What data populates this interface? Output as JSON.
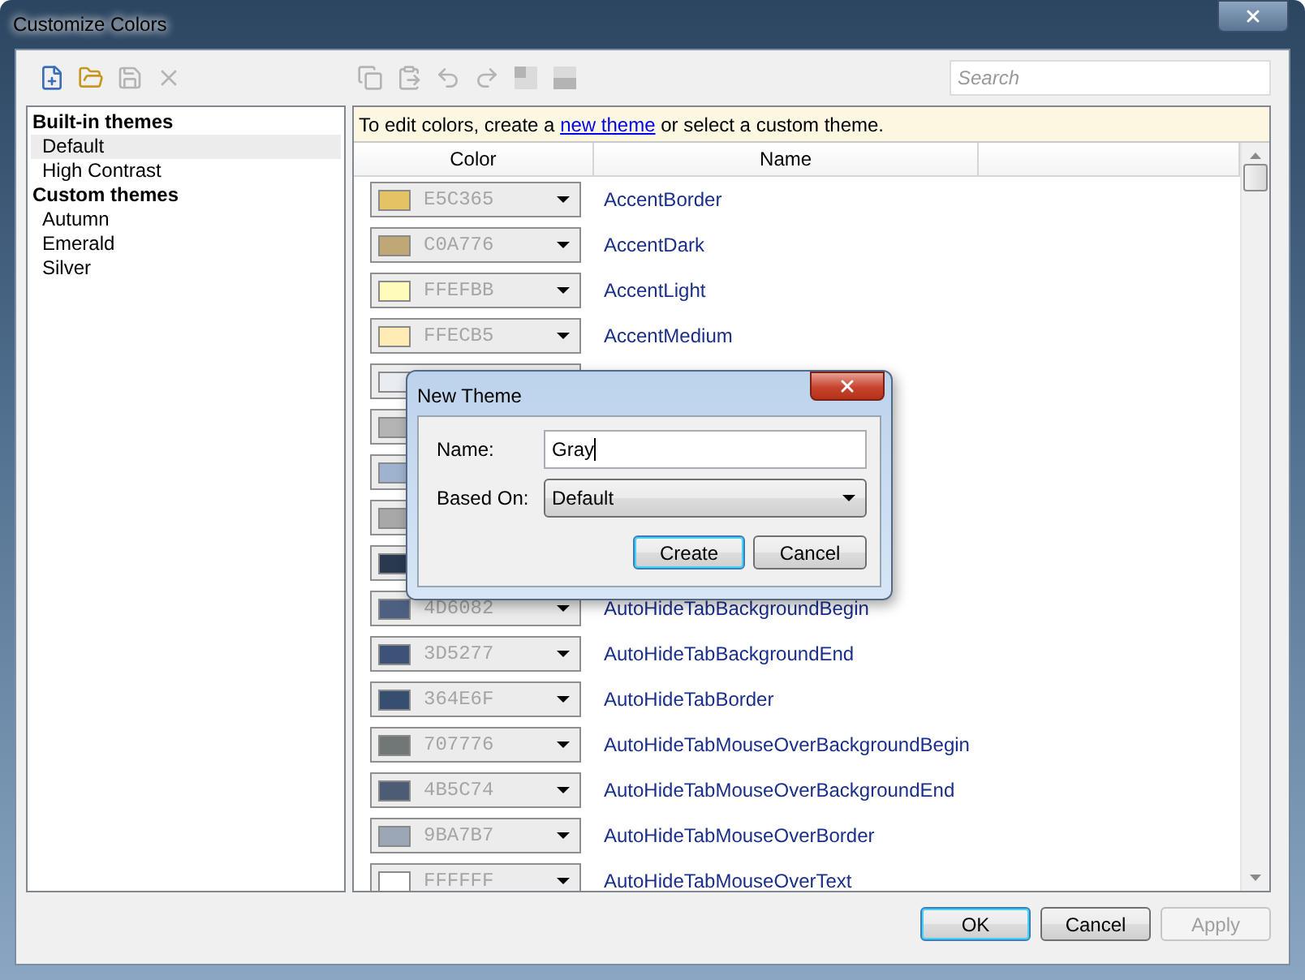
{
  "window": {
    "title": "Customize Colors"
  },
  "toolbar": [
    {
      "kind": "new",
      "disabled": false
    },
    {
      "kind": "open",
      "disabled": false
    },
    {
      "kind": "save",
      "disabled": true
    },
    {
      "kind": "delete",
      "disabled": true
    }
  ],
  "edit_toolbar": [
    {
      "kind": "copy",
      "disabled": true
    },
    {
      "kind": "paste",
      "disabled": true
    },
    {
      "kind": "undo",
      "disabled": true
    },
    {
      "kind": "redo",
      "disabled": true
    },
    {
      "kind": "grid-a",
      "disabled": true
    },
    {
      "kind": "grid-b",
      "disabled": true
    }
  ],
  "search": {
    "placeholder": "Search"
  },
  "themes": [
    {
      "heading": "Built-in themes",
      "items": [
        {
          "label": "Default",
          "selected": true
        },
        {
          "label": "High Contrast",
          "selected": false
        }
      ]
    },
    {
      "heading": "Custom themes",
      "items": [
        {
          "label": "Autumn",
          "selected": false
        },
        {
          "label": "Emerald",
          "selected": false
        },
        {
          "label": "Silver",
          "selected": false
        }
      ]
    }
  ],
  "info": {
    "before": "To edit colors, create a",
    "link": "new theme",
    "after": "or select a custom theme."
  },
  "table": {
    "columns": [
      "Color",
      "Name"
    ],
    "rows": [
      {
        "color": "#e5c365",
        "hex": "E5C365",
        "name": "AccentBorder"
      },
      {
        "color": "#c0a776",
        "hex": "C0A776",
        "name": "AccentDark"
      },
      {
        "color": "#fffbbb",
        "hex": "FFEFBB",
        "name": "AccentLight"
      },
      {
        "color": "#ffecb5",
        "hex": "FFECB5",
        "name": "AccentMedium"
      },
      {
        "color": "#e9ecf1"
      },
      {
        "color": "#b4b4b4"
      },
      {
        "color": "#9fb3cf"
      },
      {
        "color": "#a8a8a8"
      },
      {
        "color": "#293950"
      },
      {
        "color": "#4d6082",
        "hex": "4D6082",
        "name": "AutoHideTabBackgroundBegin"
      },
      {
        "color": "#3d5277",
        "hex": "3D5277",
        "name": "AutoHideTabBackgroundEnd"
      },
      {
        "color": "#364e6f",
        "hex": "364E6F",
        "name": "AutoHideTabBorder"
      },
      {
        "color": "#707776",
        "hex": "707776",
        "name": "AutoHideTabMouseOverBackgroundBegin"
      },
      {
        "color": "#4b5c74",
        "hex": "4B5C74",
        "name": "AutoHideTabMouseOverBackgroundEnd"
      },
      {
        "color": "#9ba7b7",
        "hex": "9BA7B7",
        "name": "AutoHideTabMouseOverBorder"
      },
      {
        "color": "#ffffff",
        "hex": "FFFFFF",
        "name": "AutoHideTabMouseOverText"
      }
    ]
  },
  "buttons": [
    {
      "label": "OK",
      "focused": true,
      "disabled": false
    },
    {
      "label": "Cancel",
      "focused": false,
      "disabled": false
    },
    {
      "label": "Apply",
      "focused": false,
      "disabled": true
    }
  ],
  "dialog": {
    "title": "New Theme",
    "name_label": "Name:",
    "name_value": "Gray",
    "based_on_label": "Based On:",
    "based_on_value": "Default",
    "buttons": [
      {
        "label": "Create",
        "focused": true
      },
      {
        "label": "Cancel",
        "focused": false
      }
    ]
  }
}
